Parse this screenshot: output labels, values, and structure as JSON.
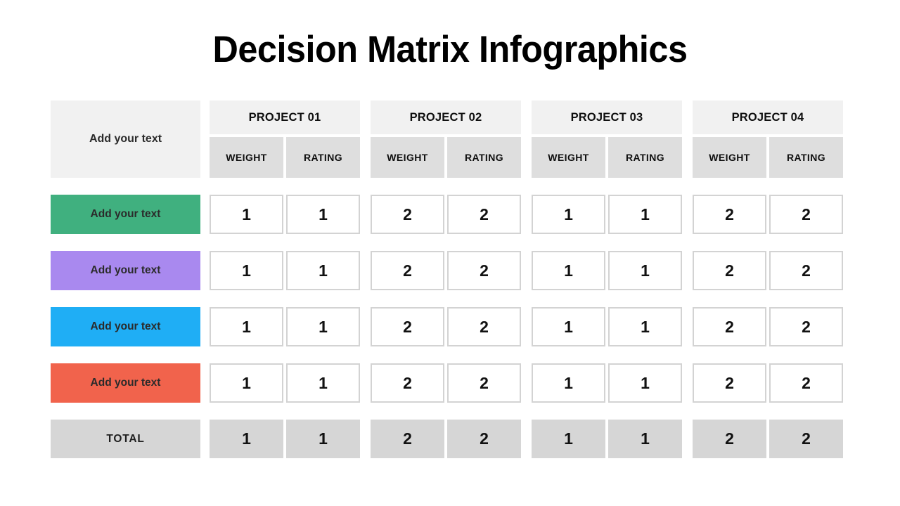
{
  "title": "Decision Matrix Infographics",
  "corner": {
    "label": "Add your text"
  },
  "projects": [
    {
      "name": "PROJECT 01",
      "weight_label": "WEIGHT",
      "rating_label": "RATING"
    },
    {
      "name": "PROJECT 02",
      "weight_label": "WEIGHT",
      "rating_label": "RATING"
    },
    {
      "name": "PROJECT 03",
      "weight_label": "WEIGHT",
      "rating_label": "RATING"
    },
    {
      "name": "PROJECT 04",
      "weight_label": "WEIGHT",
      "rating_label": "RATING"
    }
  ],
  "rows": [
    {
      "label": "Add your text",
      "color": "#40b07f",
      "values": [
        "1",
        "1",
        "2",
        "2",
        "1",
        "1",
        "2",
        "2"
      ]
    },
    {
      "label": "Add your text",
      "color": "#a989ef",
      "values": [
        "1",
        "1",
        "2",
        "2",
        "1",
        "1",
        "2",
        "2"
      ]
    },
    {
      "label": "Add your text",
      "color": "#1faef5",
      "values": [
        "1",
        "1",
        "2",
        "2",
        "1",
        "1",
        "2",
        "2"
      ]
    },
    {
      "label": "Add your text",
      "color": "#f1634c",
      "values": [
        "1",
        "1",
        "2",
        "2",
        "1",
        "1",
        "2",
        "2"
      ]
    }
  ],
  "total": {
    "label": "TOTAL",
    "values": [
      "1",
      "1",
      "2",
      "2",
      "1",
      "1",
      "2",
      "2"
    ],
    "background": "#d6d6d6"
  },
  "chart_data": {
    "type": "table",
    "title": "Decision Matrix Infographics",
    "row_header": "Add your text",
    "columns": [
      "PROJECT 01 / WEIGHT",
      "PROJECT 01 / RATING",
      "PROJECT 02 / WEIGHT",
      "PROJECT 02 / RATING",
      "PROJECT 03 / WEIGHT",
      "PROJECT 03 / RATING",
      "PROJECT 04 / WEIGHT",
      "PROJECT 04 / RATING"
    ],
    "rows": [
      {
        "name": "Add your text",
        "color": "#40b07f",
        "values": [
          1,
          1,
          2,
          2,
          1,
          1,
          2,
          2
        ]
      },
      {
        "name": "Add your text",
        "color": "#a989ef",
        "values": [
          1,
          1,
          2,
          2,
          1,
          1,
          2,
          2
        ]
      },
      {
        "name": "Add your text",
        "color": "#1faef5",
        "values": [
          1,
          1,
          2,
          2,
          1,
          1,
          2,
          2
        ]
      },
      {
        "name": "Add your text",
        "color": "#f1634c",
        "values": [
          1,
          1,
          2,
          2,
          1,
          1,
          2,
          2
        ]
      }
    ],
    "total": {
      "name": "TOTAL",
      "values": [
        1,
        1,
        2,
        2,
        1,
        1,
        2,
        2
      ]
    }
  }
}
